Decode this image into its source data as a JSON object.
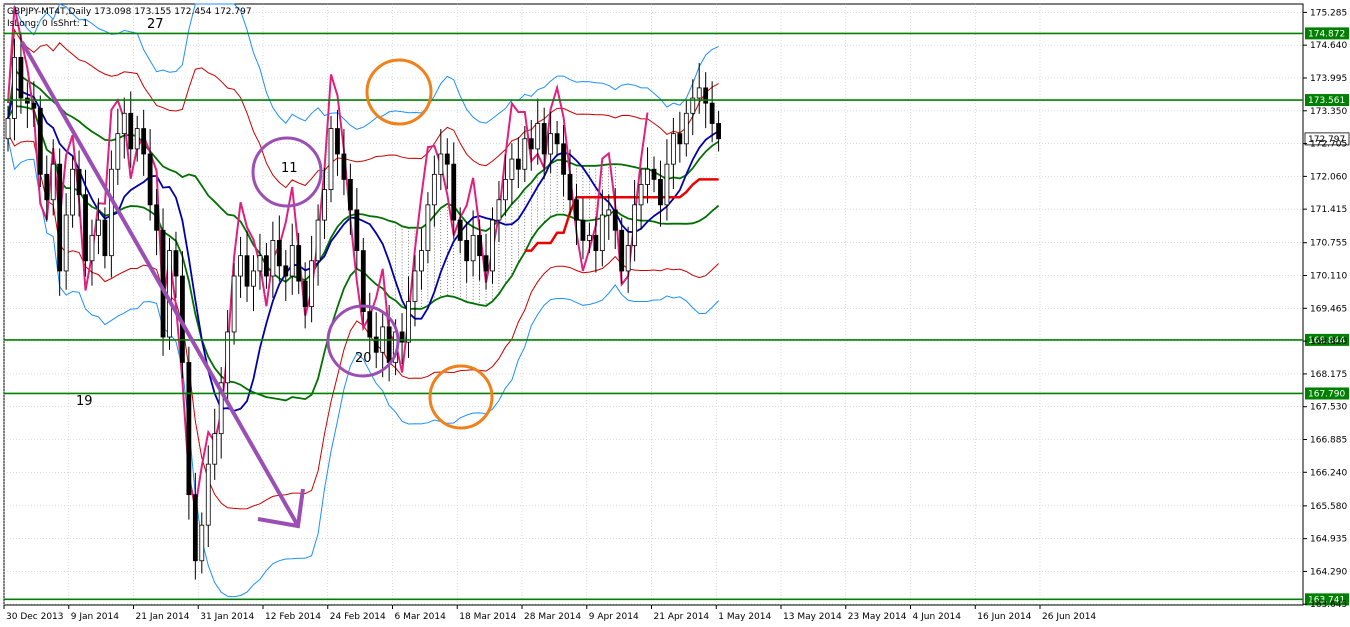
{
  "header": {
    "line1": "GBPJPY-MT4T,Daily  173.098 173.155 172.454 172.797",
    "line2": "IsLong: 0 IsShrt: 1"
  },
  "annotations": {
    "label_27": "27",
    "label_11": "11",
    "label_20": "20",
    "label_19": "19"
  },
  "chart_data": {
    "type": "line",
    "title": "GBPJPY-MT4T,Daily",
    "ohlc_readout": {
      "open": 173.098,
      "high": 173.155,
      "low": 172.454,
      "close": 172.797
    },
    "ylim": [
      163.63,
      175.45
    ],
    "grid": true,
    "y_tick_labels": [
      "175.285",
      "174.640",
      "173.995",
      "173.350",
      "172.705",
      "172.060",
      "171.415",
      "170.755",
      "170.110",
      "169.465",
      "168.820",
      "168.175",
      "167.530",
      "166.885",
      "166.240",
      "165.580",
      "164.935",
      "164.290",
      "163.645"
    ],
    "x_tick_labels": [
      "30 Dec 2013",
      "9 Jan 2014",
      "21 Jan 2014",
      "31 Jan 2014",
      "12 Feb 2014",
      "24 Feb 2014",
      "6 Mar 2014",
      "18 Mar 2014",
      "28 Mar 2014",
      "9 Apr 2014",
      "21 Apr 2014",
      "1 May 2014",
      "13 May 2014",
      "23 May 2014",
      "4 Jun 2014",
      "16 Jun 2014",
      "26 Jun 2014"
    ],
    "horizontal_levels": [
      {
        "value": 174.872,
        "label": "174.872",
        "color": "#008000"
      },
      {
        "value": 173.561,
        "label": "173.561",
        "color": "#008000"
      },
      {
        "value": 168.844,
        "label": "168.844",
        "color": "#008000"
      },
      {
        "value": 167.79,
        "label": "167.790",
        "color": "#008000"
      },
      {
        "value": 163.741,
        "label": "163.741",
        "color": "#008000"
      }
    ],
    "current_price": {
      "value": 172.797,
      "label": "172.797"
    },
    "colors": {
      "up_candle": "#ffffff",
      "down_candle": "#000000",
      "wick": "#000000",
      "level": "#008000",
      "outer_band": "#1e90ff",
      "inner_band": "#cc0000",
      "mid_band": "#007000",
      "ma_blue": "#0000aa",
      "pink": "#e0207f",
      "kijun": "#ee0000",
      "senkou": "#f0c000",
      "trend_arrow": "#9b4fb4",
      "circle_orange": "#f0801a",
      "circle_purple": "#9b4fb4",
      "cloud_hatch": "#000000"
    },
    "candles_close": [
      173.2,
      174.4,
      173.6,
      173.5,
      173.4,
      172.1,
      171.6,
      172.3,
      170.2,
      171.3,
      172.2,
      171.7,
      170.4,
      170.9,
      171.2,
      170.5,
      172.2,
      172.9,
      173.3,
      172.6,
      173.0,
      172.5,
      171.5,
      171.0,
      168.9,
      170.6,
      170.1,
      168.4,
      165.8,
      164.5,
      165.2,
      166.4,
      167.0,
      168.0,
      169.0,
      170.1,
      170.5,
      169.9,
      170.2,
      170.5,
      170.1,
      170.8,
      170.3,
      170.1,
      170.7,
      170.0,
      169.5,
      170.4,
      171.2,
      171.8,
      173.0,
      172.5,
      172.0,
      171.4,
      170.6,
      169.4,
      168.9,
      168.6,
      169.1,
      168.4,
      169.0,
      168.8,
      169.6,
      170.2,
      170.6,
      171.5,
      172.1,
      172.5,
      172.3,
      171.2,
      170.8,
      170.4,
      170.9,
      170.5,
      170.2,
      171.2,
      171.6,
      172.0,
      172.4,
      172.2,
      172.8,
      172.6,
      173.1,
      172.5,
      172.9,
      172.7,
      172.1,
      171.6,
      171.2,
      170.8,
      170.9,
      170.6,
      171.3,
      171.4,
      171.0,
      170.2,
      170.7,
      171.5,
      171.9,
      172.2,
      172.0,
      171.5,
      172.3,
      172.9,
      172.7,
      173.3,
      173.6,
      173.8,
      173.5,
      173.1,
      172.8
    ]
  }
}
